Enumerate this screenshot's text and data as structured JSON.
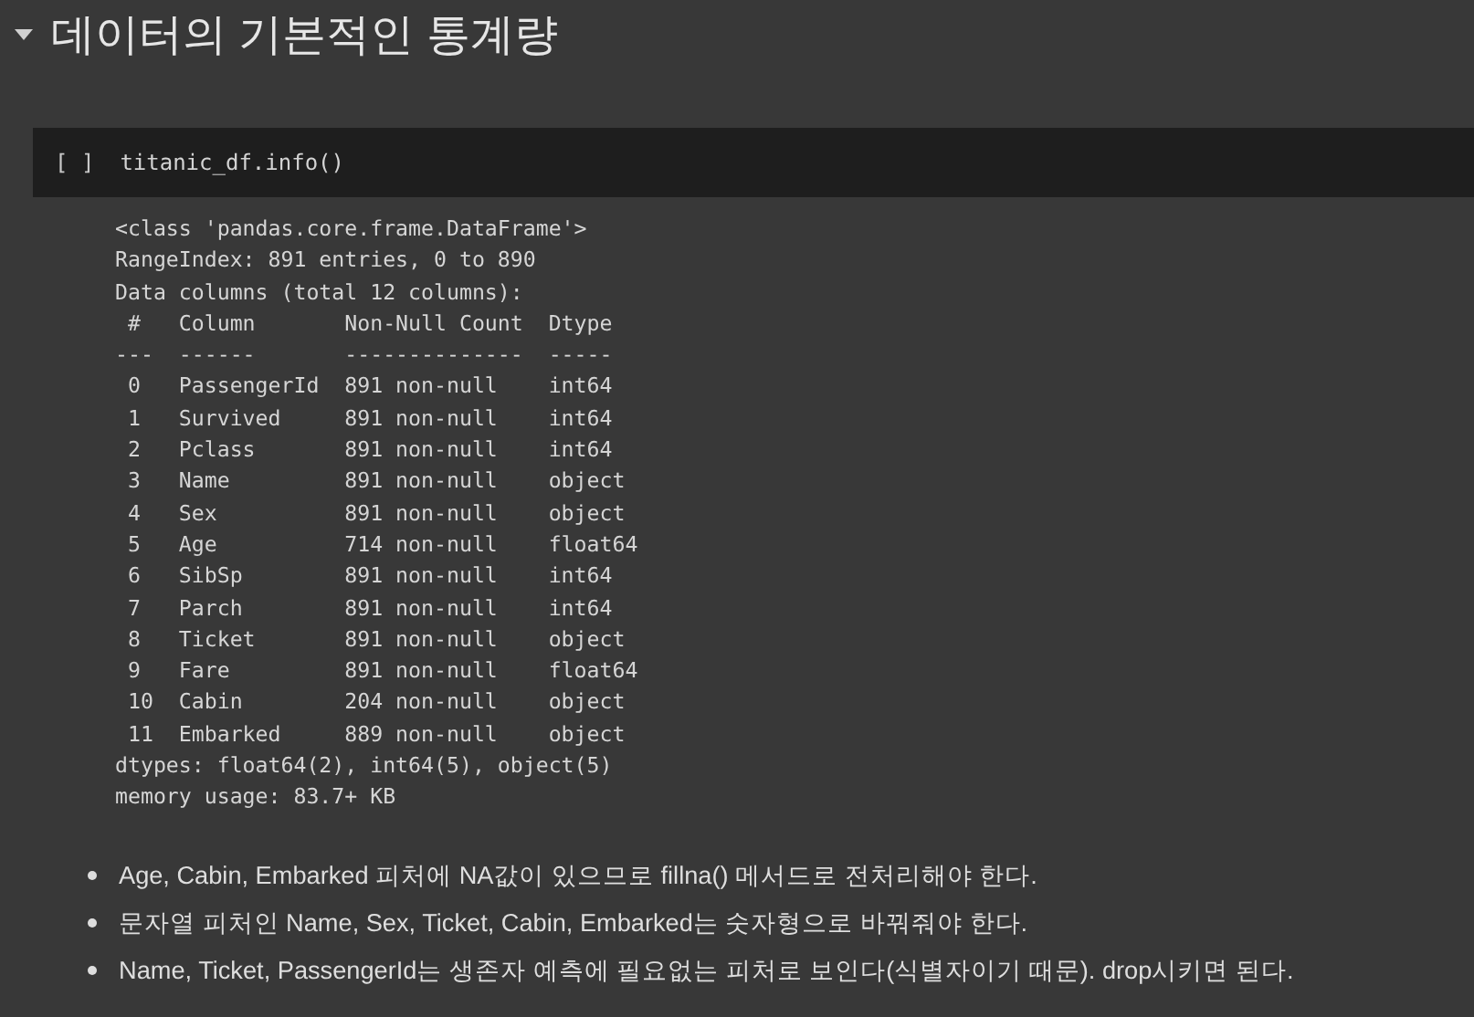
{
  "section": {
    "title": "데이터의 기본적인 통계량",
    "expanded": true
  },
  "code_cell": {
    "run_marker": "[ ]",
    "code": "titanic_df.info()"
  },
  "output": {
    "lines": [
      "<class 'pandas.core.frame.DataFrame'>",
      "RangeIndex: 891 entries, 0 to 890",
      "Data columns (total 12 columns):",
      " #   Column       Non-Null Count  Dtype  ",
      "---  ------       --------------  -----  ",
      " 0   PassengerId  891 non-null    int64  ",
      " 1   Survived     891 non-null    int64  ",
      " 2   Pclass       891 non-null    int64  ",
      " 3   Name         891 non-null    object ",
      " 4   Sex          891 non-null    object ",
      " 5   Age          714 non-null    float64",
      " 6   SibSp        891 non-null    int64  ",
      " 7   Parch        891 non-null    int64  ",
      " 8   Ticket       891 non-null    object ",
      " 9   Fare         891 non-null    float64",
      " 10  Cabin        204 non-null    object ",
      " 11  Embarked     889 non-null    object ",
      "dtypes: float64(2), int64(5), object(5)",
      "memory usage: 83.7+ KB"
    ]
  },
  "bullets": [
    "Age, Cabin, Embarked 피처에 NA값이 있으므로 fillna() 메서드로 전처리해야 한다.",
    "문자열 피처인 Name, Sex, Ticket, Cabin, Embarked는 숫자형으로 바꿔줘야 한다.",
    "Name, Ticket, PassengerId는 생존자 예측에 필요없는 피처로 보인다(식별자이기 때문). drop시키면 된다."
  ]
}
